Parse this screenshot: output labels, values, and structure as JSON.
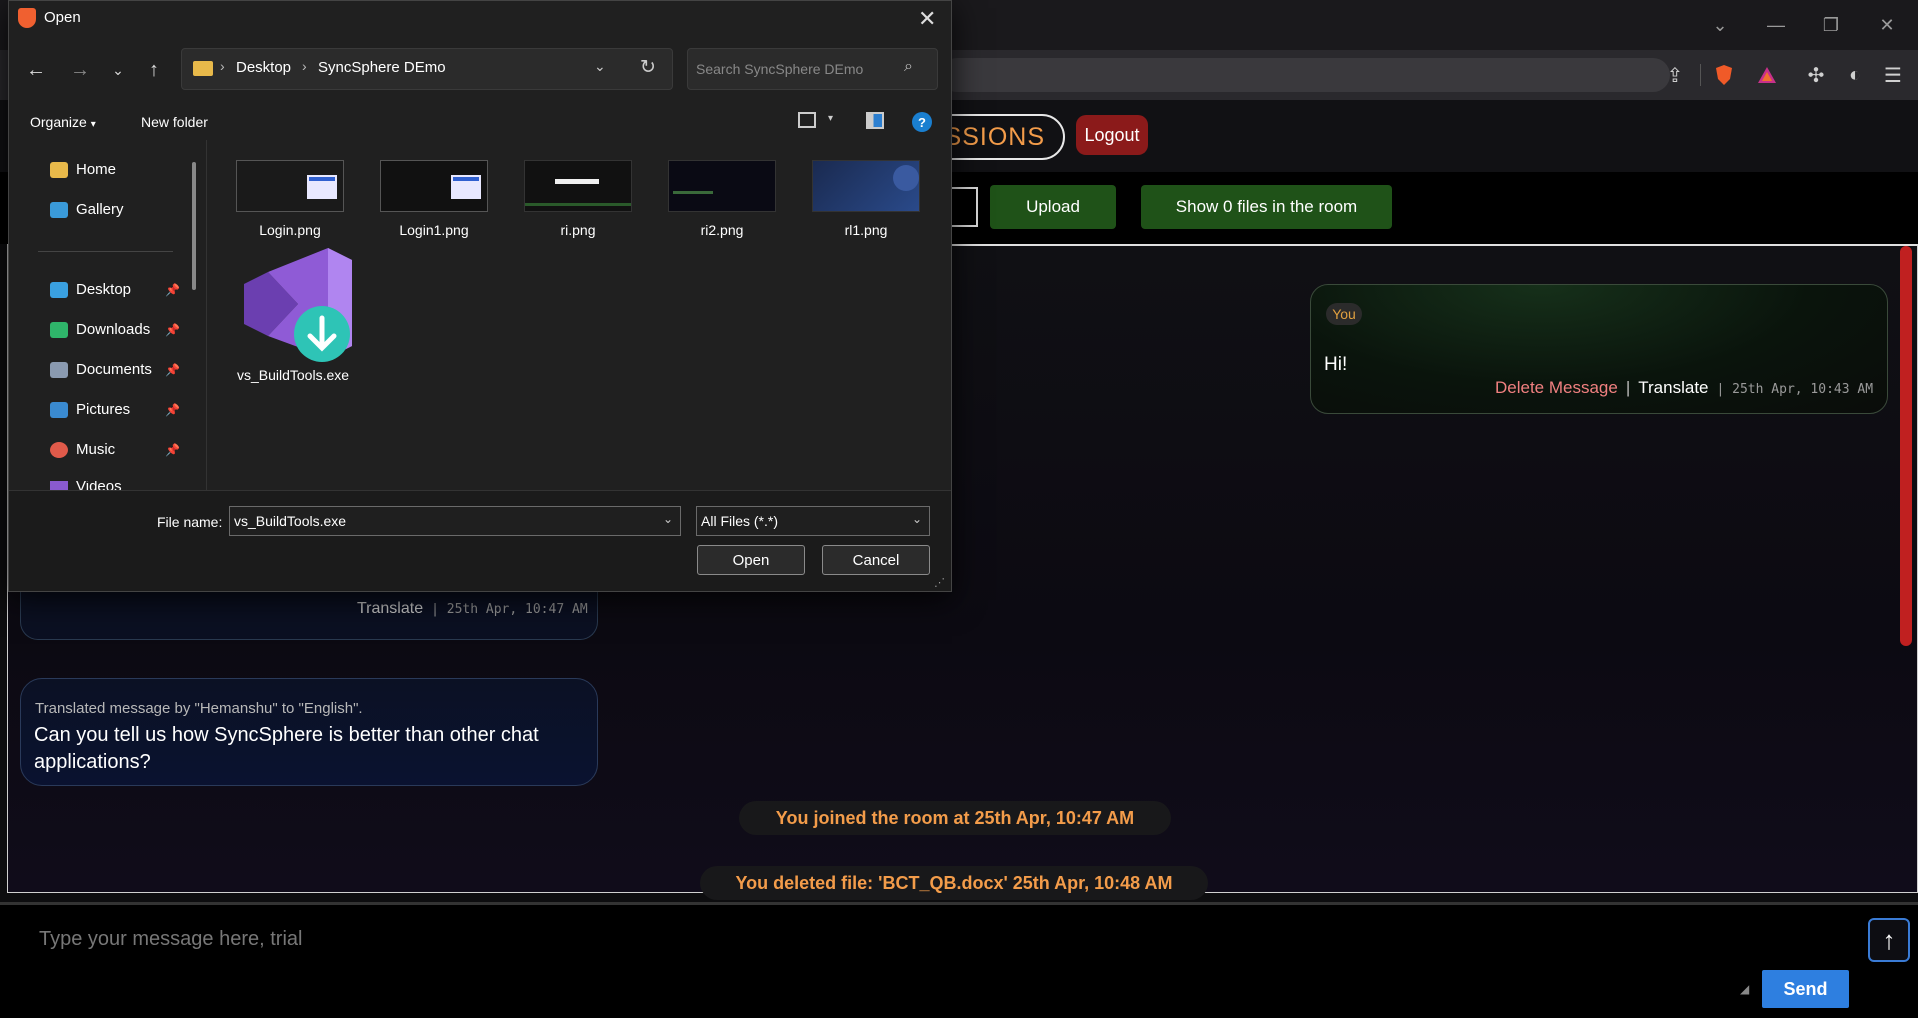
{
  "browser": {
    "minimize": "—",
    "restore": "❐",
    "close": "✕",
    "chevron": "⌄"
  },
  "header": {
    "permissions_label": "ISSIONS",
    "logout_label": "Logout"
  },
  "toolbar": {
    "upload_label": "Upload",
    "show_files_label": "Show 0 files in the room"
  },
  "chat": {
    "my_message": {
      "sender": "You",
      "text": "Hi!",
      "delete_label": "Delete Message",
      "separator": "|",
      "translate_label": "Translate",
      "timestamp": "| 25th Apr, 10:43 AM"
    },
    "partial_message": {
      "text": "...",
      "translate_label": "Translate",
      "timestamp": "| 25th Apr, 10:47 AM"
    },
    "translated_message": {
      "note": "Translated message by \"Hemanshu\" to \"English\".",
      "text": "Can you tell us how SyncSphere is better than other chat applications?"
    },
    "system_messages": [
      "You joined the room at 25th Apr, 10:47 AM",
      "You deleted file: 'BCT_QB.docx' 25th Apr, 10:48 AM"
    ]
  },
  "composer": {
    "placeholder": "Type your message here, trial",
    "send_label": "Send",
    "scroll_up_label": "↑"
  },
  "dialog": {
    "title": "Open",
    "close": "✕",
    "breadcrumbs": [
      "Desktop",
      "SyncSphere DEmo"
    ],
    "search_placeholder": "Search SyncSphere DEmo",
    "organize_label": "Organize",
    "new_folder_label": "New folder",
    "help_label": "?",
    "nav_items": [
      {
        "label": "Home",
        "icon": "home-icon",
        "color": "#e8b94a",
        "pinned": false
      },
      {
        "label": "Gallery",
        "icon": "gallery-icon",
        "color": "#3a9ad9",
        "pinned": false
      },
      {
        "label": "Desktop",
        "icon": "desktop-icon",
        "color": "#3aa0e0",
        "pinned": true
      },
      {
        "label": "Downloads",
        "icon": "downloads-icon",
        "color": "#2fb56a",
        "pinned": true
      },
      {
        "label": "Documents",
        "icon": "documents-icon",
        "color": "#8a9ab0",
        "pinned": true
      },
      {
        "label": "Pictures",
        "icon": "pictures-icon",
        "color": "#3a8ad0",
        "pinned": true
      },
      {
        "label": "Music",
        "icon": "music-icon",
        "color": "#e05a4a",
        "pinned": true
      },
      {
        "label": "Videos",
        "icon": "videos-icon",
        "color": "#8a5ad0",
        "pinned": true
      }
    ],
    "files": [
      {
        "name": "Login.png",
        "kind": "light"
      },
      {
        "name": "Login1.png",
        "kind": "light"
      },
      {
        "name": "ri.png",
        "kind": "dark"
      },
      {
        "name": "ri2.png",
        "kind": "dark"
      },
      {
        "name": "rl1.png",
        "kind": "blue"
      },
      {
        "name": "vs_BuildTools.exe",
        "kind": "exe"
      }
    ],
    "file_name_label": "File name:",
    "file_name_value": "vs_BuildTools.exe",
    "file_type_value": "All Files (*.*)",
    "open_label": "Open",
    "cancel_label": "Cancel"
  }
}
